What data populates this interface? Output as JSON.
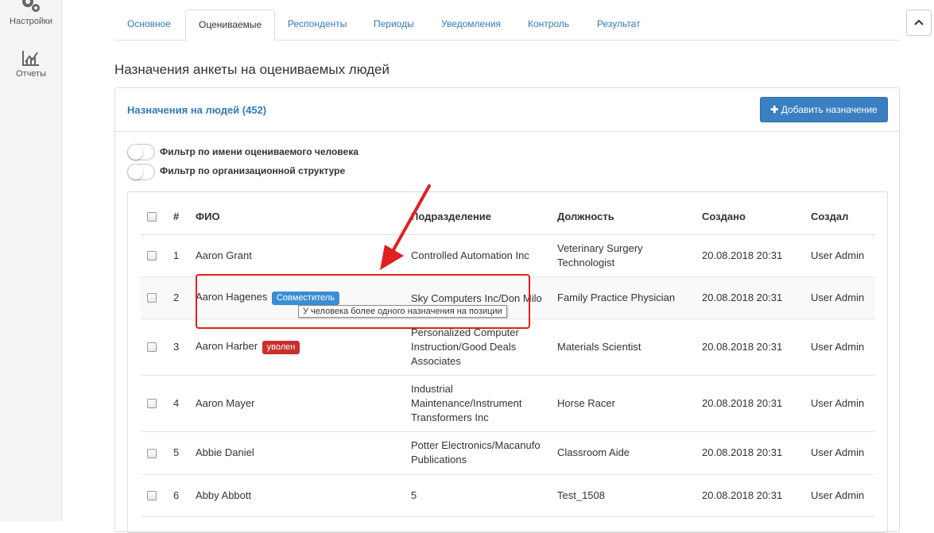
{
  "sidebar": {
    "items": [
      {
        "label": "Настройки",
        "icon": "gears-icon"
      },
      {
        "label": "Отчеты",
        "icon": "chart-icon"
      }
    ]
  },
  "tabs": [
    {
      "label": "Основное",
      "active": false
    },
    {
      "label": "Оцениваемые",
      "active": true
    },
    {
      "label": "Респонденты",
      "active": false
    },
    {
      "label": "Периоды",
      "active": false
    },
    {
      "label": "Уведомления",
      "active": false
    },
    {
      "label": "Контроль",
      "active": false
    },
    {
      "label": "Результат",
      "active": false
    }
  ],
  "page": {
    "title": "Назначения анкеты на оцениваемых людей"
  },
  "panel": {
    "title": "Назначения на людей (452)",
    "add_button": "Добавить назначение",
    "filters": [
      {
        "label": "Фильтр по имени оцениваемого человека",
        "on": false
      },
      {
        "label": "Фильтр по организационной структуре",
        "on": false
      }
    ]
  },
  "table": {
    "columns": [
      "#",
      "ФИО",
      "Подразделение",
      "Должность",
      "Создано",
      "Создал"
    ],
    "rows": [
      {
        "num": "1",
        "name": "Aaron Grant",
        "badge": "",
        "dept": "Controlled Automation Inc",
        "position": "Veterinary Surgery Technologist",
        "created": "20.08.2018 20:31",
        "author": "User Admin"
      },
      {
        "num": "2",
        "name": "Aaron Hagenes",
        "badge": "Совместитель",
        "dept": "Sky Computers Inc/Don Milo Consulting",
        "position": "Family Practice Physician",
        "created": "20.08.2018 20:31",
        "author": "User Admin"
      },
      {
        "num": "3",
        "name": "Aaron Harber",
        "badge": "уволен",
        "dept": "Personalized Computer Instruction/Good Deals Associates",
        "position": "Materials Scientist",
        "created": "20.08.2018 20:31",
        "author": "User Admin"
      },
      {
        "num": "4",
        "name": "Aaron Mayer",
        "badge": "",
        "dept": "Industrial Maintenance/Instrument Transformers Inc",
        "position": "Horse Racer",
        "created": "20.08.2018 20:31",
        "author": "User Admin"
      },
      {
        "num": "5",
        "name": "Abbie Daniel",
        "badge": "",
        "dept": "Potter Electronics/Macanufo Publications",
        "position": "Classroom Aide",
        "created": "20.08.2018 20:31",
        "author": "User Admin"
      },
      {
        "num": "6",
        "name": "Abby Abbott",
        "badge": "",
        "dept": "5",
        "position": "Test_1508",
        "created": "20.08.2018 20:31",
        "author": "User Admin"
      }
    ]
  },
  "tooltip": {
    "text": "У человека более одного назначения на позиции"
  },
  "colors": {
    "link": "#337ab7",
    "primary_button": "#3a7fc1",
    "badge_info": "#3a8ed3",
    "badge_danger": "#c9302c",
    "annotation": "#e02020"
  }
}
